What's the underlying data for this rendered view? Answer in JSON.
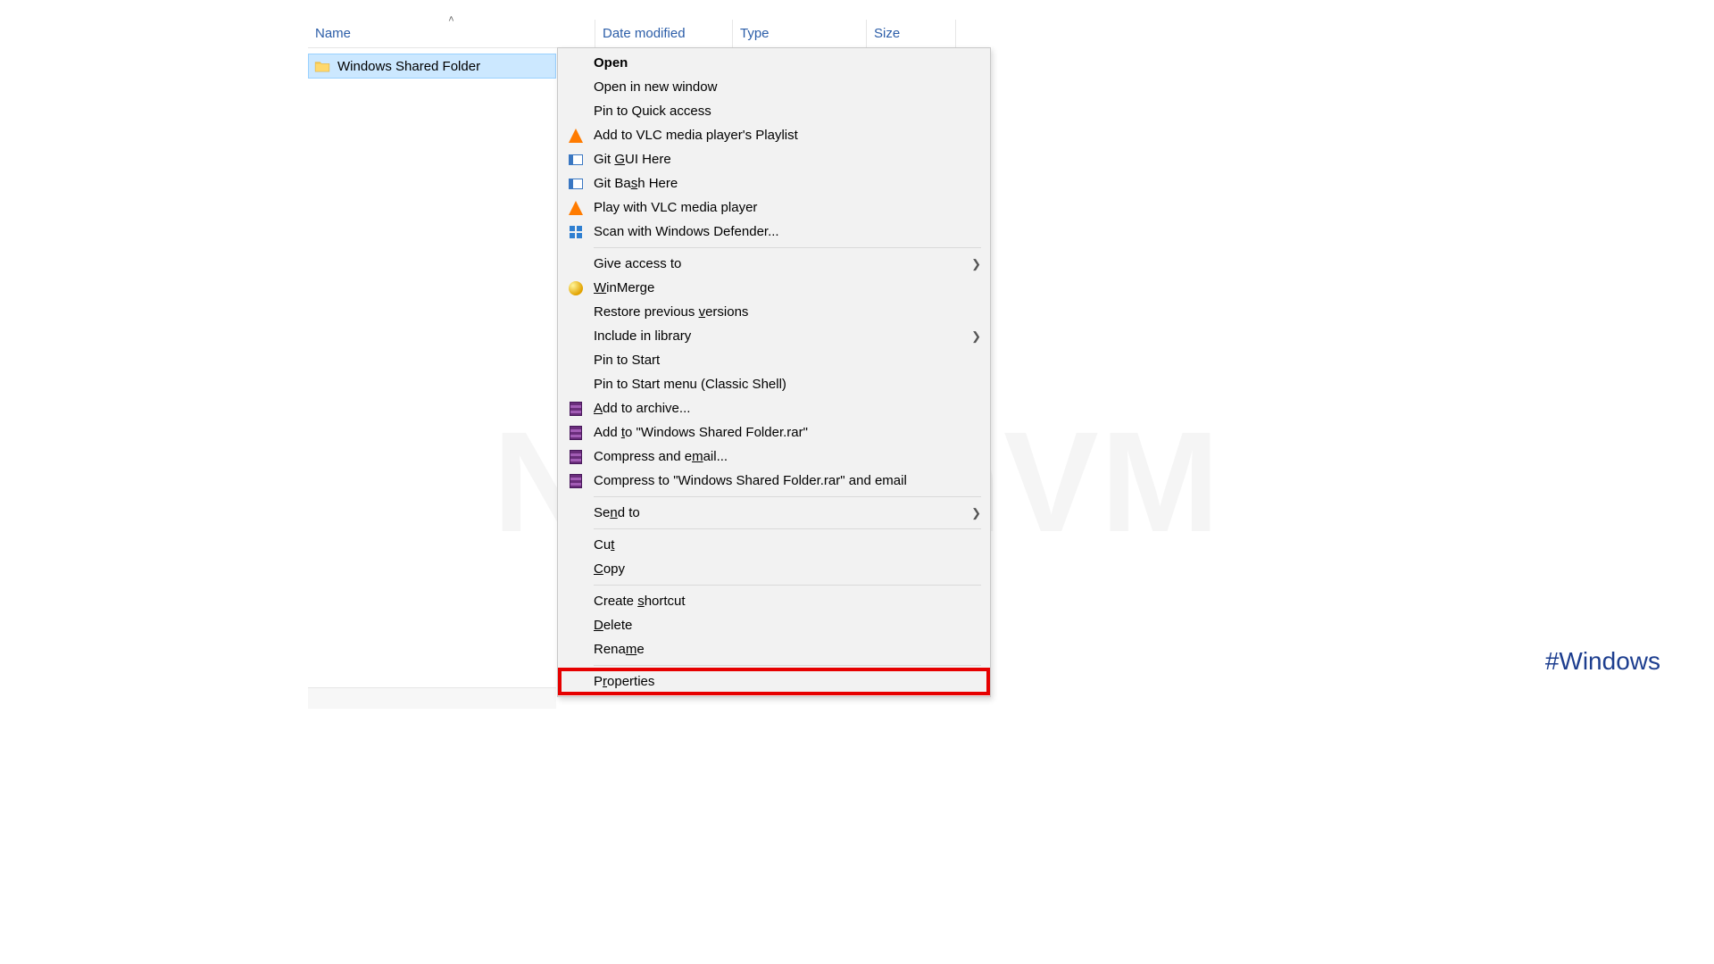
{
  "watermark_text": "NeuronVM",
  "hashtag_text": "#Windows",
  "headers": {
    "name": "Name",
    "date": "Date modified",
    "type": "Type",
    "size": "Size"
  },
  "file": {
    "name": "Windows Shared Folder"
  },
  "menu": {
    "open": "Open",
    "open_new_window": "Open in new window",
    "pin_quick": "Pin to Quick access",
    "add_vlc": "Add to VLC media player's Playlist",
    "git_gui_pre": "Git ",
    "git_gui_key": "G",
    "git_gui_post": "UI Here",
    "git_bash_pre": "Git Ba",
    "git_bash_key": "s",
    "git_bash_post": "h Here",
    "play_vlc": "Play with VLC media player",
    "scan_defender": "Scan with Windows Defender...",
    "give_access": "Give access to",
    "winmerge_key": "W",
    "winmerge_post": "inMerge",
    "restore_pre": "Restore previous ",
    "restore_key": "v",
    "restore_post": "ersions",
    "include_lib": "Include in library",
    "pin_start": "Pin to Start",
    "pin_start_classic": "Pin to Start menu (Classic Shell)",
    "add_archive_pre": "",
    "add_archive_key": "A",
    "add_archive_post": "dd to archive...",
    "add_rar_pre": "Add ",
    "add_rar_key": "t",
    "add_rar_post": "o \"Windows Shared Folder.rar\"",
    "compress_email_pre": "Compress and e",
    "compress_email_key": "m",
    "compress_email_post": "ail...",
    "compress_rar_email": "Compress to \"Windows Shared Folder.rar\" and email",
    "send_to_pre": "Se",
    "send_to_key": "n",
    "send_to_post": "d to",
    "cut_pre": "Cu",
    "cut_key": "t",
    "copy_key": "C",
    "copy_post": "opy",
    "create_sc_pre": "Create ",
    "create_sc_key": "s",
    "create_sc_post": "hortcut",
    "delete_key": "D",
    "delete_post": "elete",
    "rename_pre": "Rena",
    "rename_key": "m",
    "rename_post": "e",
    "properties_pre": "P",
    "properties_key": "r",
    "properties_post": "operties"
  }
}
